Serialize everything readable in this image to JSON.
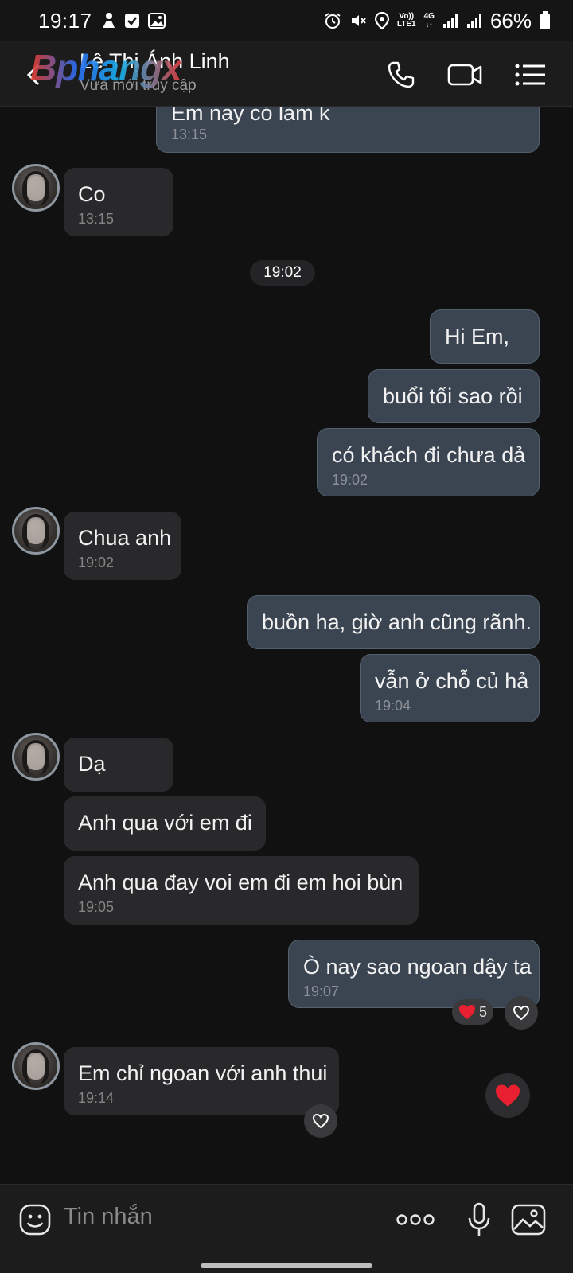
{
  "status_bar": {
    "time": "19:17",
    "net_top": "Vo))",
    "net_bottom": "LTE1",
    "net_4g": "4G",
    "battery": "66%"
  },
  "header": {
    "contact_name": "Lê Thị Ánh Linh",
    "contact_status": "Vừa mới truy cập",
    "watermark": "Bphangx"
  },
  "messages": [
    {
      "direction": "out",
      "text": "Em nay có làm k",
      "time": "13:15"
    },
    {
      "direction": "in",
      "text": "Co",
      "time": "13:15"
    },
    {
      "direction": "out",
      "text": "Hi Em,",
      "time": ""
    },
    {
      "direction": "out",
      "text": "buổi tối sao rồi",
      "time": ""
    },
    {
      "direction": "out",
      "text": "có khách đi chưa dả",
      "time": "19:02"
    },
    {
      "direction": "in",
      "text": "Chua anh",
      "time": "19:02"
    },
    {
      "direction": "out",
      "text": "buồn ha, giờ anh cũng rãnh.",
      "time": ""
    },
    {
      "direction": "out",
      "text": "vẫn ở chỗ củ hả",
      "time": "19:04"
    },
    {
      "direction": "in",
      "text": "Dạ",
      "time": ""
    },
    {
      "direction": "in",
      "text": "Anh qua với em đi",
      "time": ""
    },
    {
      "direction": "in",
      "text": "Anh qua đay voi em đi em hoi bùn",
      "time": "19:05"
    },
    {
      "direction": "out",
      "text": "Ò nay sao ngoan dậy ta",
      "time": "19:07"
    },
    {
      "direction": "in",
      "text": "Em chỉ ngoan với anh thui",
      "time": "19:14"
    }
  ],
  "date_separator": "19:02",
  "reaction_count": "5",
  "input": {
    "placeholder": "Tin nhắn"
  },
  "icons": {
    "accent_heart": "#e8202f",
    "out_bubble": "#3b4552",
    "in_bubble": "#29292b"
  }
}
